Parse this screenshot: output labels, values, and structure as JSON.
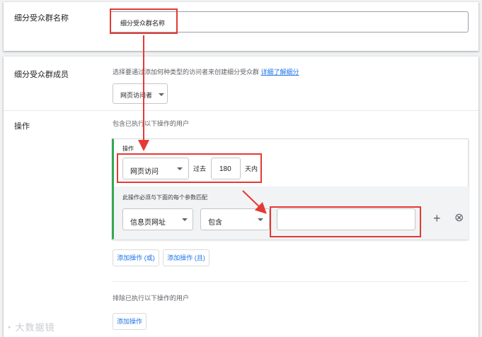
{
  "audience_name": {
    "label": "细分受众群名称",
    "input_value": "细分受众群名称"
  },
  "members": {
    "label": "细分受众群成员",
    "description": "选择要通过添加何种类型的访问者来创建细分受众群",
    "learn_more": "详细了解细分",
    "visitor_type": "网页访问者"
  },
  "action": {
    "label": "操作",
    "include_text": "包含已执行以下操作的用户",
    "panel_title": "操作",
    "action_select": "网页访问",
    "past_label": "过去",
    "days_value": "180",
    "days_unit": "天内",
    "param_hint": "此操作必须与下面的每个参数匹配",
    "param_field": "信息页网址",
    "param_operator": "包含",
    "param_value": "",
    "add_or": "添加操作 (或)",
    "add_and": "添加操作 (且)",
    "exclude_text": "排除已执行以下操作的用户",
    "add_action": "添加操作"
  },
  "icons": {
    "plus": "+",
    "remove": "⊗"
  },
  "watermark": "大数据镜"
}
